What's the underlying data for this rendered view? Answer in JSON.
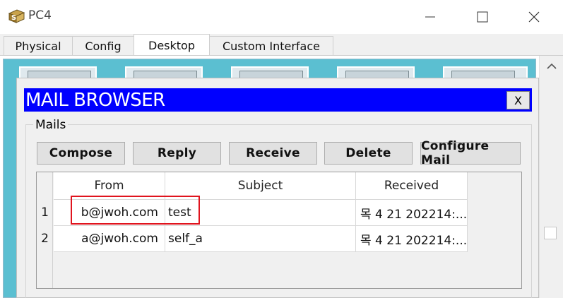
{
  "window": {
    "title": "PC4",
    "controls": [
      "minimize-icon",
      "maximize-icon",
      "close-icon"
    ]
  },
  "tabs": [
    {
      "label": "Physical",
      "active": false
    },
    {
      "label": "Config",
      "active": false
    },
    {
      "label": "Desktop",
      "active": true
    },
    {
      "label": "Custom Interface",
      "active": false
    }
  ],
  "mail_browser": {
    "title": "MAIL BROWSER",
    "close_label": "X",
    "group_label": "Mails",
    "buttons": {
      "compose": "Compose",
      "reply": "Reply",
      "receive": "Receive",
      "delete": "Delete",
      "configure": "Configure Mail"
    },
    "table": {
      "headers": {
        "from": "From",
        "subject": "Subject",
        "received": "Received"
      },
      "rows": [
        {
          "num": "1",
          "from": "b@jwoh.com",
          "subject": "test",
          "received": "목 4 21 202214:..."
        },
        {
          "num": "2",
          "from": "a@jwoh.com",
          "subject": "self_a",
          "received": "목 4 21 202214:..."
        }
      ]
    }
  },
  "colors": {
    "title_bar_blue": "#0000ff",
    "desktop_bg": "#5bbfd1",
    "highlight_red": "#e0141e"
  }
}
